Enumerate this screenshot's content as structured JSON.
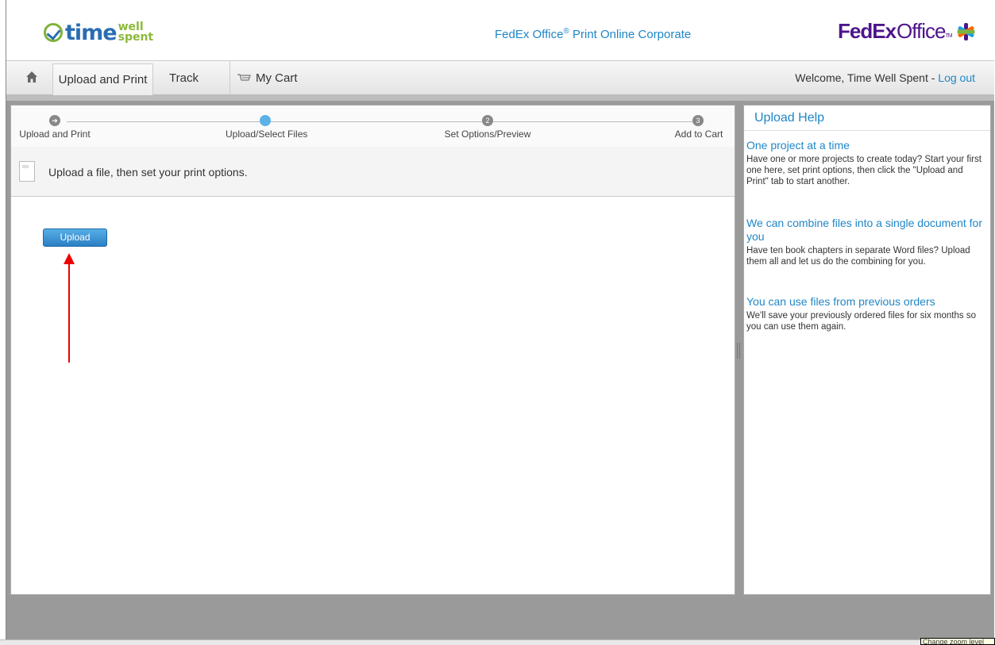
{
  "header": {
    "logo_text_main": "time",
    "logo_text_top": "well",
    "logo_text_bottom": "spent",
    "title_prefix": "FedEx Office",
    "title_reg": "®",
    "title_suffix": " Print Online Corporate",
    "fedex_fed": "Fed",
    "fedex_ex": "Ex",
    "fedex_office": "Office",
    "fedex_tm": "TM",
    "fedex_star_colors": [
      "#4d148c",
      "#ff6600",
      "#21a0db",
      "#7cb342"
    ]
  },
  "nav": {
    "home_icon": "home-icon",
    "tabs": [
      {
        "label": "Upload and Print",
        "active": true
      },
      {
        "label": "Track",
        "active": false
      },
      {
        "label": "My Cart",
        "active": false
      }
    ],
    "welcome_text": "Welcome, Time Well Spent - ",
    "logout_label": "Log out"
  },
  "steps": [
    {
      "label": "Upload and Print",
      "marker": "➜",
      "state": "done"
    },
    {
      "label": "Upload/Select Files",
      "marker": "",
      "state": "current"
    },
    {
      "label": "Set Options/Preview",
      "marker": "2",
      "state": "pending"
    },
    {
      "label": "Add to Cart",
      "marker": "3",
      "state": "pending"
    }
  ],
  "instruction": "Upload a file, then set your print options.",
  "upload_button_label": "Upload",
  "help": {
    "title": "Upload Help",
    "items": [
      {
        "heading": "One project at a time",
        "body": "Have one or more projects to create today?  Start your first one here, set print options, then click the \"Upload and Print\" tab to start another."
      },
      {
        "heading": "We can combine files into a single document for you",
        "body": "Have ten book chapters in separate Word files? Upload them all and let us do the combining for you."
      },
      {
        "heading": "You can use files from previous orders",
        "body": "We'll save your previously ordered files for six months so you can use them again."
      }
    ]
  },
  "tooltip": "Change zoom level",
  "colors": {
    "accent": "#1f86c7",
    "fedex_purple": "#4d148c",
    "annotation_arrow": "#ee0000",
    "button_blue": "#2a7fc4"
  }
}
